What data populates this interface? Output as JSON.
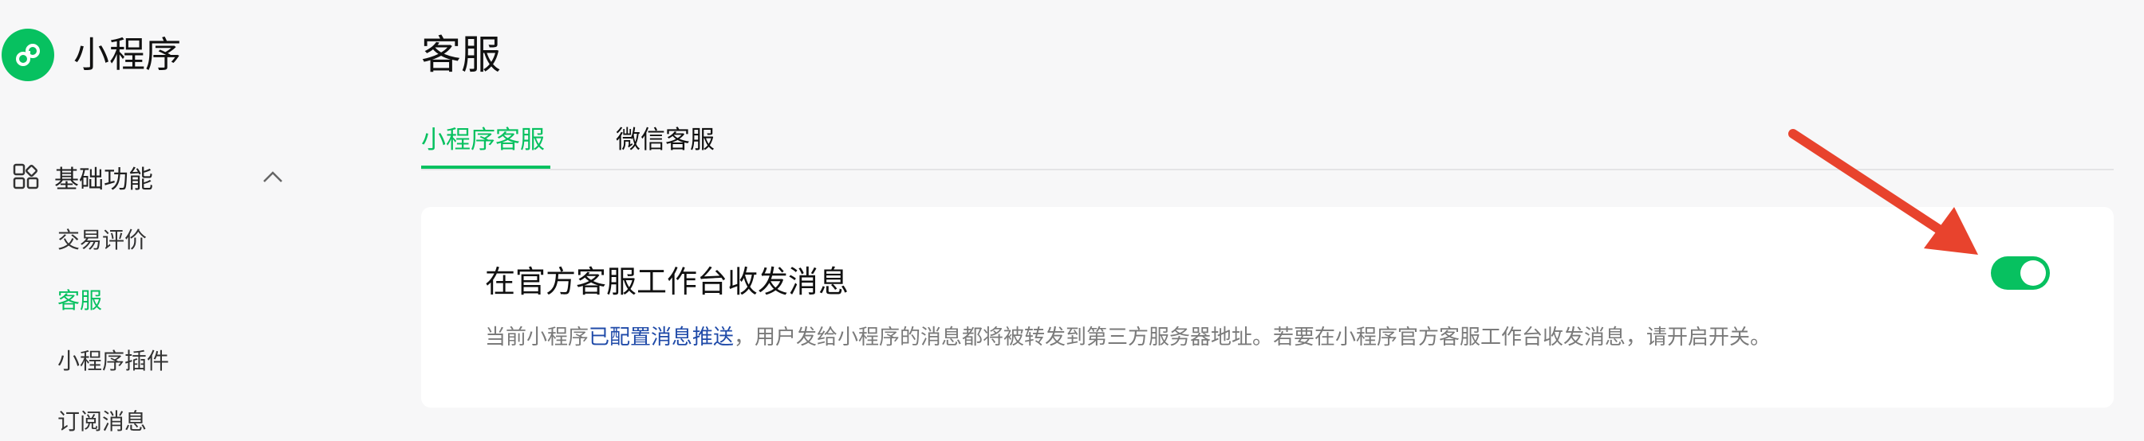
{
  "app": {
    "title": "小程序",
    "logo_icon": "mini-program-logo-icon",
    "brand_color": "#07c160"
  },
  "sidebar": {
    "group": {
      "label": "基础功能",
      "icon": "grid-icon",
      "expanded": true
    },
    "items": [
      {
        "label": "交易评价",
        "active": false
      },
      {
        "label": "客服",
        "active": true
      },
      {
        "label": "小程序插件",
        "active": false
      },
      {
        "label": "订阅消息",
        "active": false
      }
    ]
  },
  "page": {
    "title": "客服"
  },
  "tabs": [
    {
      "label": "小程序客服",
      "active": true
    },
    {
      "label": "微信客服",
      "active": false
    }
  ],
  "card": {
    "title": "在官方客服工作台收发消息",
    "desc_before": "当前小程序",
    "desc_link": "已配置消息推送",
    "desc_after": "，用户发给小程序的消息都将被转发到第三方服务器地址。若要在小程序官方客服工作台收发消息，请开启开关。",
    "toggle_on": true,
    "link_color": "#1f4aa8"
  },
  "annotation": {
    "arrow_color": "#e8432d"
  }
}
